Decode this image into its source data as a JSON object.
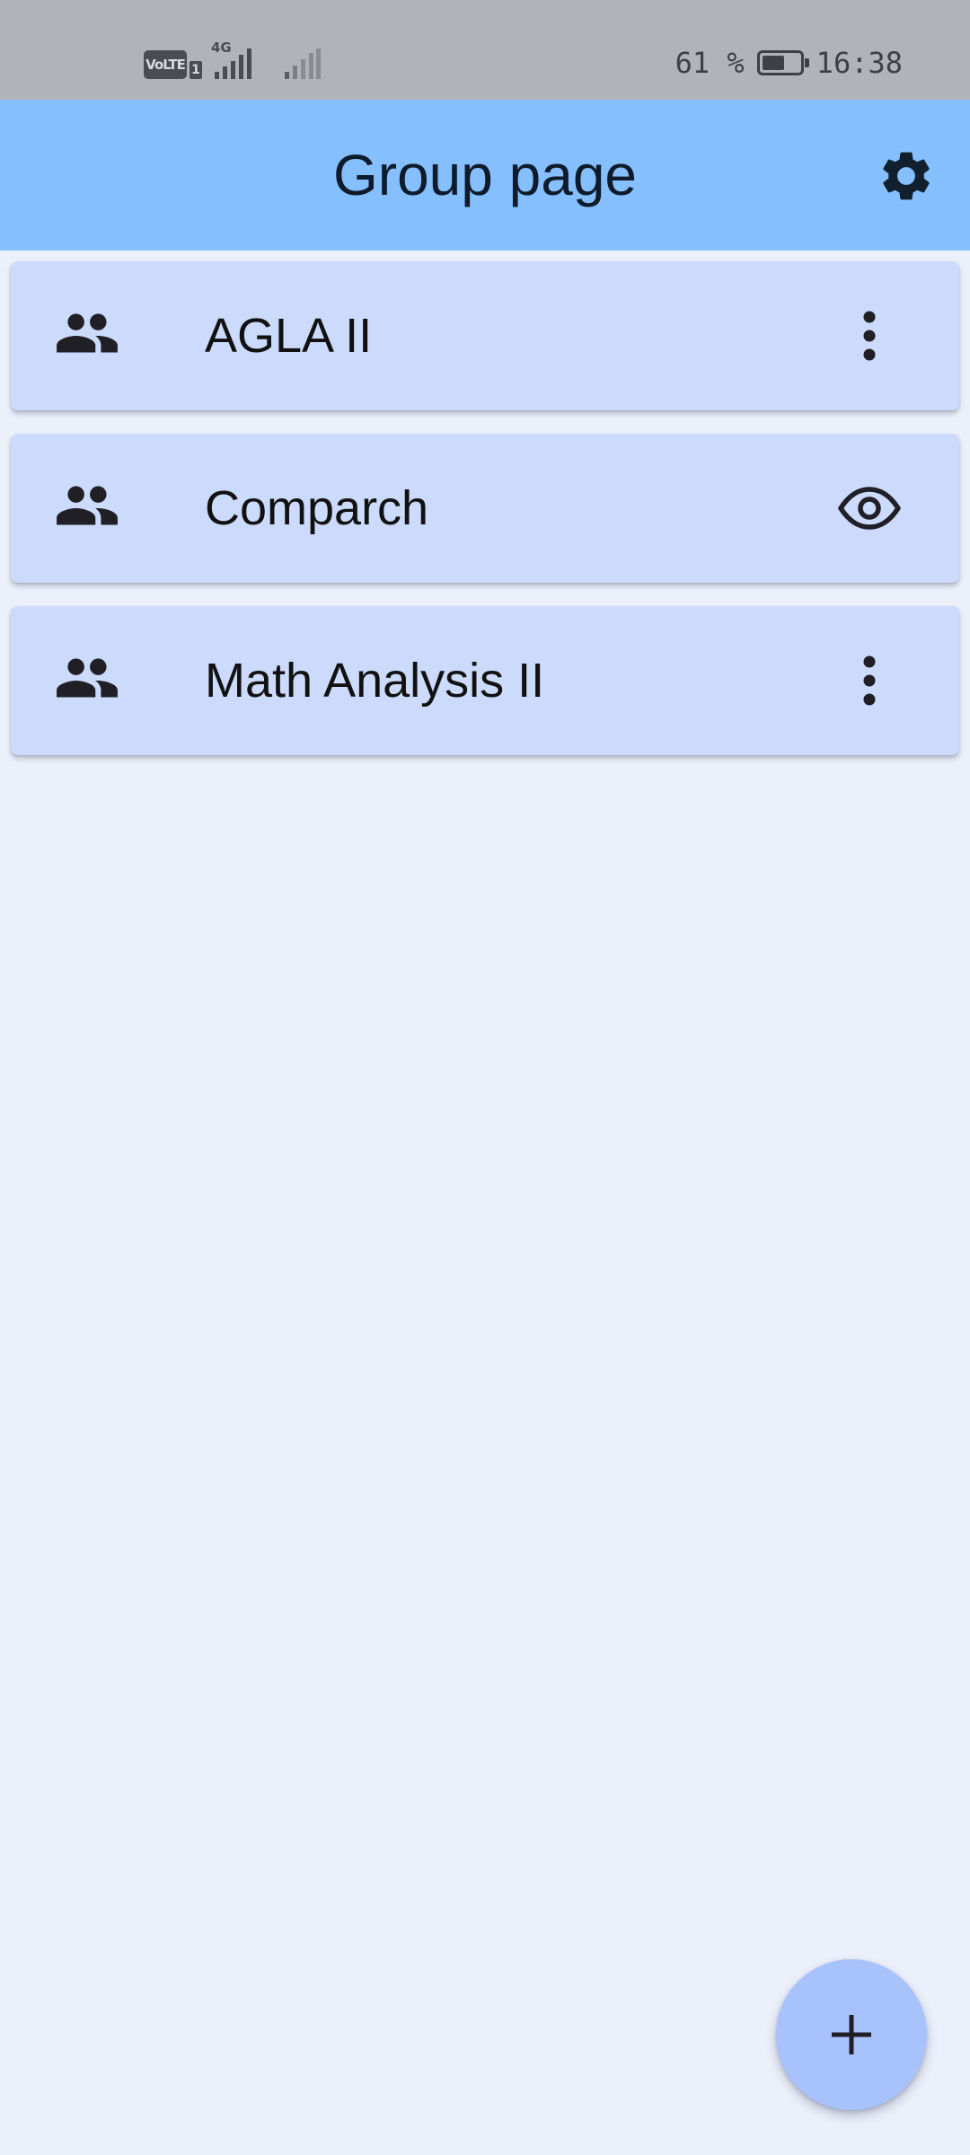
{
  "status_bar": {
    "volte_label": "VoLTE",
    "sim_number": "1",
    "network_type": "4G",
    "battery_percent_text": "61 %",
    "battery_level": 0.61,
    "time": "16:38"
  },
  "app_bar": {
    "title": "Group page",
    "settings_icon": "gear-icon"
  },
  "groups": [
    {
      "name": "AGLA II",
      "icon": "group-icon",
      "action_icon": "more-vertical-icon"
    },
    {
      "name": "Comparch",
      "icon": "group-icon",
      "action_icon": "eye-icon"
    },
    {
      "name": "Math Analysis II",
      "icon": "group-icon",
      "action_icon": "more-vertical-icon"
    }
  ],
  "fab": {
    "icon": "plus-icon"
  },
  "colors": {
    "status_bar_bg": "#B1B3B9",
    "app_bar_bg": "#85BFFE",
    "page_bg": "#ECF0FA",
    "card_bg": "#CCDAFB",
    "fab_bg": "#A8C2FC",
    "icon_dark": "#1F1F25"
  }
}
